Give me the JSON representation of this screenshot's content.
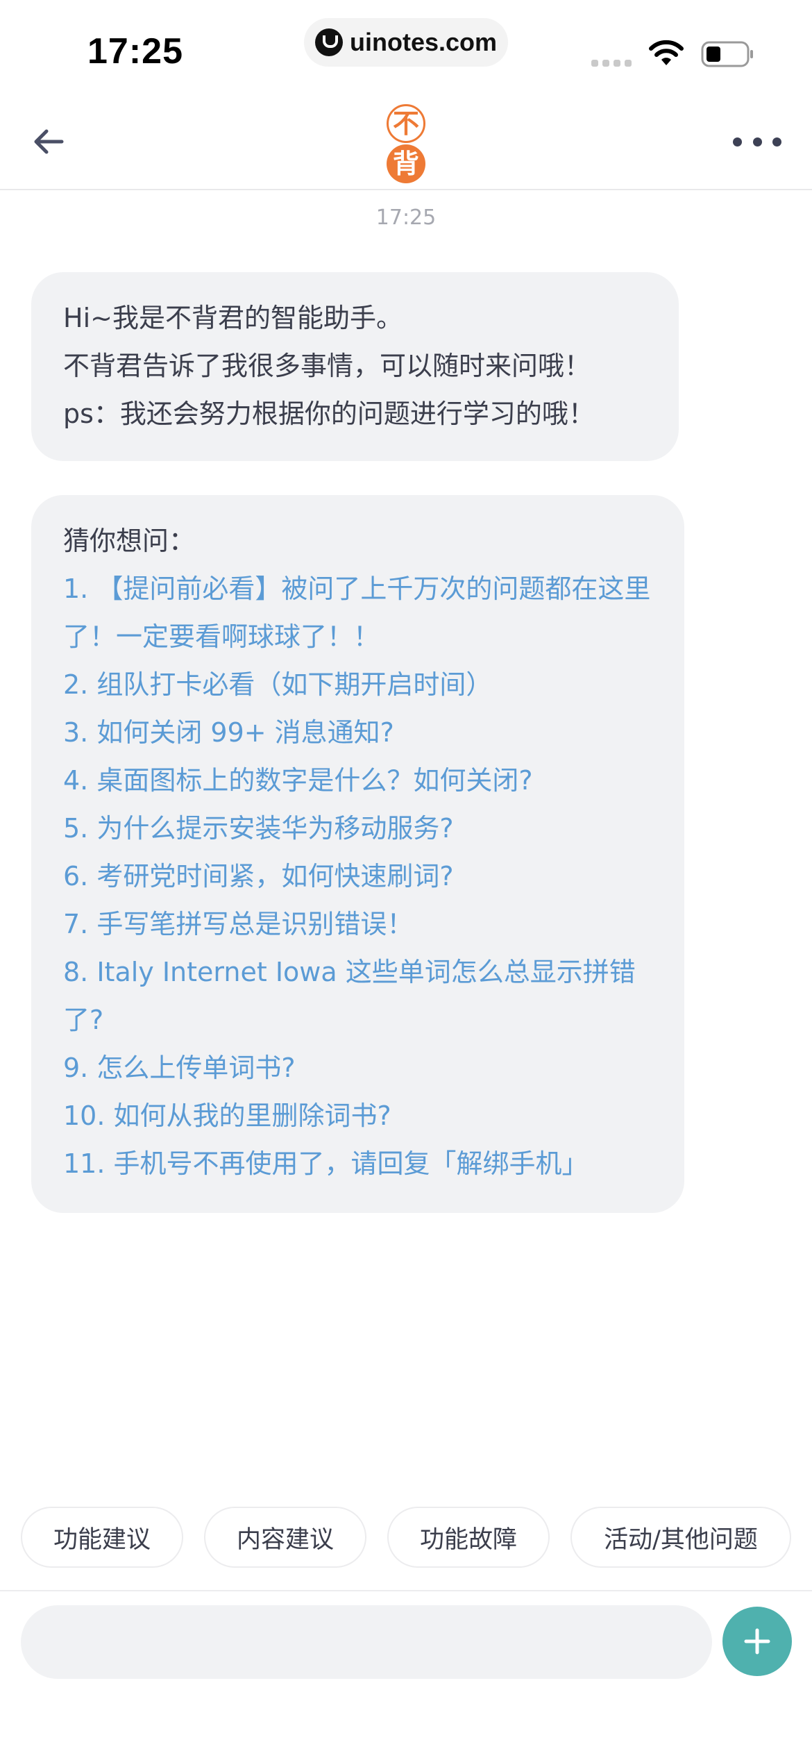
{
  "status_bar": {
    "time": "17:25",
    "url": "uinotes.com",
    "icons": [
      "signal-icon",
      "wifi-icon",
      "battery-icon"
    ]
  },
  "nav": {
    "back_icon": "arrow-left-icon",
    "logo_top": "不",
    "logo_bottom": "背",
    "more_icon": "more-dots-icon"
  },
  "chat": {
    "timestamp": "17:25",
    "greeting": {
      "lines": [
        "Hi~我是不背君的智能助手。",
        "不背君告诉了我很多事情，可以随时来问哦！",
        "ps：我还会努力根据你的问题进行学习的哦！"
      ]
    },
    "suggestions": {
      "heading": "猜你想问：",
      "items": [
        "1. 【提问前必看】被问了上千万次的问题都在这里了！一定要看啊球球了！！",
        "2. 组队打卡必看（如下期开启时间）",
        "3. 如何关闭 99+ 消息通知?",
        "4. 桌面图标上的数字是什么？如何关闭?",
        "5. 为什么提示安装华为移动服务?",
        "6. 考研党时间紧，如何快速刷词?",
        "7. 手写笔拼写总是识别错误！",
        "8. Italy Internet Iowa 这些单词怎么总显示拼错了?",
        "9. 怎么上传单词书?",
        "10. 如何从我的里删除词书?",
        "11. 手机号不再使用了，请回复「解绑手机」"
      ]
    }
  },
  "quick_replies": [
    "功能建议",
    "内容建议",
    "功能故障",
    "活动/其他问题"
  ],
  "composer": {
    "placeholder": "",
    "add_icon": "plus-icon"
  },
  "colors": {
    "accent": "#4fb1ae",
    "link": "#5b9bd5",
    "logo": "#ee7a35",
    "bubble": "#f1f2f4"
  }
}
